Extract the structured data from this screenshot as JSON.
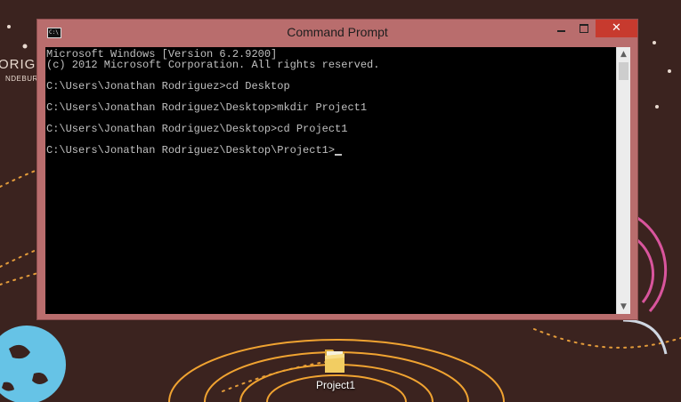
{
  "desktop": {
    "wallpaper_text_line1": "ORIGINA",
    "wallpaper_text_line2": "NDEBURGH",
    "icons": [
      {
        "label": "Project1",
        "icon": "folder-icon"
      }
    ]
  },
  "window": {
    "title": "Command Prompt",
    "app_icon": "cmd-icon",
    "app_icon_text": "C:\\",
    "controls": {
      "minimize": "minimize-icon",
      "maximize": "maximize-icon",
      "close": "✕"
    },
    "colors": {
      "frame": "#b96d6d",
      "close_button": "#c73a2e",
      "console_background": "#000000",
      "console_text": "#c0c0c0"
    }
  },
  "console": {
    "lines": [
      "Microsoft Windows [Version 6.2.9200]",
      "(c) 2012 Microsoft Corporation. All rights reserved.",
      "",
      "C:\\Users\\Jonathan Rodriguez>cd Desktop",
      "",
      "C:\\Users\\Jonathan Rodriguez\\Desktop>mkdir Project1",
      "",
      "C:\\Users\\Jonathan Rodriguez\\Desktop>cd Project1",
      "",
      "C:\\Users\\Jonathan Rodriguez\\Desktop\\Project1>"
    ]
  },
  "scrollbar": {
    "up_arrow": "▲",
    "down_arrow": "▼"
  }
}
